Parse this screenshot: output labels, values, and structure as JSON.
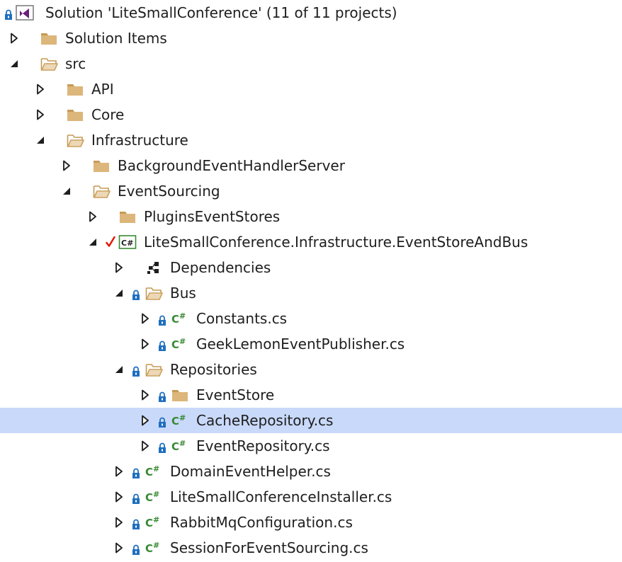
{
  "solution_explorer": {
    "items": [
      {
        "label": "Solution 'LiteSmallConference' (11 of 11 projects)",
        "level": 0,
        "expander": "none",
        "icon": "solution-icon",
        "locked": true,
        "checked": false,
        "selected": false
      },
      {
        "label": "Solution Items",
        "level": 0,
        "expander": "collapsed",
        "icon": "folder-icon",
        "locked": false,
        "checked": false,
        "selected": false
      },
      {
        "label": "src",
        "level": 0,
        "expander": "expanded",
        "icon": "folder-open-icon",
        "locked": false,
        "checked": false,
        "selected": false
      },
      {
        "label": "API",
        "level": 1,
        "expander": "collapsed",
        "icon": "folder-icon",
        "locked": false,
        "checked": false,
        "selected": false
      },
      {
        "label": "Core",
        "level": 1,
        "expander": "collapsed",
        "icon": "folder-icon",
        "locked": false,
        "checked": false,
        "selected": false
      },
      {
        "label": "Infrastructure",
        "level": 1,
        "expander": "expanded",
        "icon": "folder-open-icon",
        "locked": false,
        "checked": false,
        "selected": false
      },
      {
        "label": "BackgroundEventHandlerServer",
        "level": 2,
        "expander": "collapsed",
        "icon": "folder-icon",
        "locked": false,
        "checked": false,
        "selected": false
      },
      {
        "label": "EventSourcing",
        "level": 2,
        "expander": "expanded",
        "icon": "folder-open-icon",
        "locked": false,
        "checked": false,
        "selected": false
      },
      {
        "label": "PluginsEventStores",
        "level": 3,
        "expander": "collapsed",
        "icon": "folder-icon",
        "locked": false,
        "checked": false,
        "selected": false
      },
      {
        "label": "LiteSmallConference.Infrastructure.EventStoreAndBus",
        "level": 3,
        "expander": "expanded",
        "icon": "csproj-icon",
        "locked": false,
        "checked": true,
        "selected": false
      },
      {
        "label": "Dependencies",
        "level": 4,
        "expander": "collapsed",
        "icon": "dependencies-icon",
        "locked": false,
        "checked": false,
        "selected": false
      },
      {
        "label": "Bus",
        "level": 4,
        "expander": "expanded",
        "icon": "folder-open-icon",
        "locked": true,
        "checked": false,
        "selected": false
      },
      {
        "label": "Constants.cs",
        "level": 5,
        "expander": "collapsed",
        "icon": "csharp-file-icon",
        "locked": true,
        "checked": false,
        "selected": false
      },
      {
        "label": "GeekLemonEventPublisher.cs",
        "level": 5,
        "expander": "collapsed",
        "icon": "csharp-file-icon",
        "locked": true,
        "checked": false,
        "selected": false
      },
      {
        "label": "Repositories",
        "level": 4,
        "expander": "expanded",
        "icon": "folder-open-icon",
        "locked": true,
        "checked": false,
        "selected": false
      },
      {
        "label": "EventStore",
        "level": 5,
        "expander": "collapsed",
        "icon": "folder-icon",
        "locked": true,
        "checked": false,
        "selected": false
      },
      {
        "label": "CacheRepository.cs",
        "level": 5,
        "expander": "collapsed",
        "icon": "csharp-file-icon",
        "locked": true,
        "checked": false,
        "selected": true
      },
      {
        "label": "EventRepository.cs",
        "level": 5,
        "expander": "collapsed",
        "icon": "csharp-file-icon",
        "locked": true,
        "checked": false,
        "selected": false
      },
      {
        "label": "DomainEventHelper.cs",
        "level": 4,
        "expander": "collapsed",
        "icon": "csharp-file-icon",
        "locked": true,
        "checked": false,
        "selected": false
      },
      {
        "label": "LiteSmallConferenceInstaller.cs",
        "level": 4,
        "expander": "collapsed",
        "icon": "csharp-file-icon",
        "locked": true,
        "checked": false,
        "selected": false
      },
      {
        "label": "RabbitMqConfiguration.cs",
        "level": 4,
        "expander": "collapsed",
        "icon": "csharp-file-icon",
        "locked": true,
        "checked": false,
        "selected": false
      },
      {
        "label": "SessionForEventSourcing.cs",
        "level": 4,
        "expander": "collapsed",
        "icon": "csharp-file-icon",
        "locked": true,
        "checked": false,
        "selected": false
      }
    ]
  },
  "colors": {
    "selection": "#c9d9f9",
    "folder": "#dcb67a",
    "folder_dark": "#c59a55",
    "lock": "#1f6fbf",
    "csharp": "#388a34",
    "check": "#e51400",
    "solution": "#68217a",
    "text": "#1e1e1e"
  }
}
